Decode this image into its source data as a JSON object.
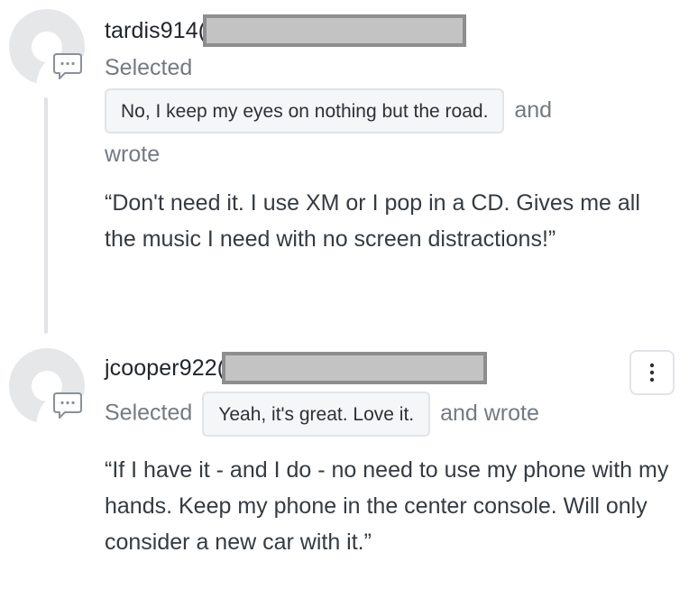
{
  "comments": [
    {
      "username": "tardis914(",
      "selected_label": "Selected",
      "choice": "No, I keep my eyes on nothing but the road.",
      "connector": "and",
      "wrote_label": "wrote",
      "quote": "“Don't need it. I use XM or I pop in a CD. Gives me all the music I need with no screen distractions!”"
    },
    {
      "username": "jcooper922(",
      "selected_label": "Selected",
      "choice": "Yeah, it's great. Love it.",
      "connector": "and wrote",
      "quote": "“If I have it - and I do - no need to use my phone with my hands. Keep my phone in the center console. Will only consider a new car with it.”"
    }
  ],
  "icons": {
    "avatar": "avatar-placeholder-icon",
    "comment": "comment-bubble-icon",
    "menu": "more-vertical-icon"
  },
  "colors": {
    "avatar_gray": "#e6e7e9",
    "thread_line": "#e1e3e6",
    "chip_bg": "#f5f6f8",
    "chip_border": "#e1e4e8",
    "redaction_fill": "#c3c3c3",
    "redaction_border": "#8e8e8e"
  }
}
